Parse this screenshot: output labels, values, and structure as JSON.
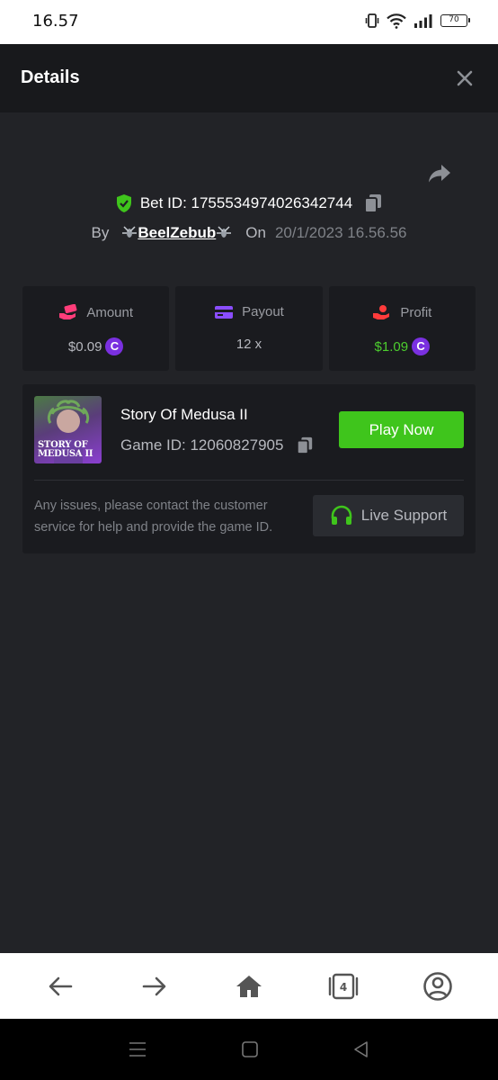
{
  "status_bar": {
    "time": "16.57",
    "battery": "70",
    "icons": [
      "vibrate-icon",
      "wifi-icon",
      "signal-icon",
      "battery-icon"
    ]
  },
  "header": {
    "title": "Details",
    "close_icon": "close-icon"
  },
  "bet": {
    "bet_id_label": "Bet ID: 1755534974026342744",
    "by_label": "By",
    "username": "BeelZebub",
    "on_label": "On",
    "date": "20/1/2023 16.56.56"
  },
  "stats": {
    "amount": {
      "label": "Amount",
      "value": "$0.09",
      "icon": "money-hand-icon"
    },
    "payout": {
      "label": "Payout",
      "value": "12 x",
      "icon": "card-icon"
    },
    "profit": {
      "label": "Profit",
      "value": "$1.09",
      "icon": "profit-hand-icon"
    },
    "coin_symbol": "C"
  },
  "game": {
    "title": "Story Of Medusa II",
    "game_id_label": "Game ID: 12060827905",
    "thumb_text_line1": "STORY OF",
    "thumb_text_line2": "MEDUSA II",
    "play_button": "Play Now",
    "support_text": "Any issues, please contact the customer service for help and provide the game ID.",
    "support_button": "Live Support"
  },
  "bottom_nav": {
    "tabs_count": "4",
    "items": [
      "back-icon",
      "forward-icon",
      "home-icon",
      "tabs-icon",
      "account-icon"
    ]
  },
  "colors": {
    "accent_green": "#3fc51c",
    "profit_green": "#4ccd2e",
    "coin_purple": "#7a30e0",
    "background": "#222327",
    "card": "#1a1b1f"
  }
}
